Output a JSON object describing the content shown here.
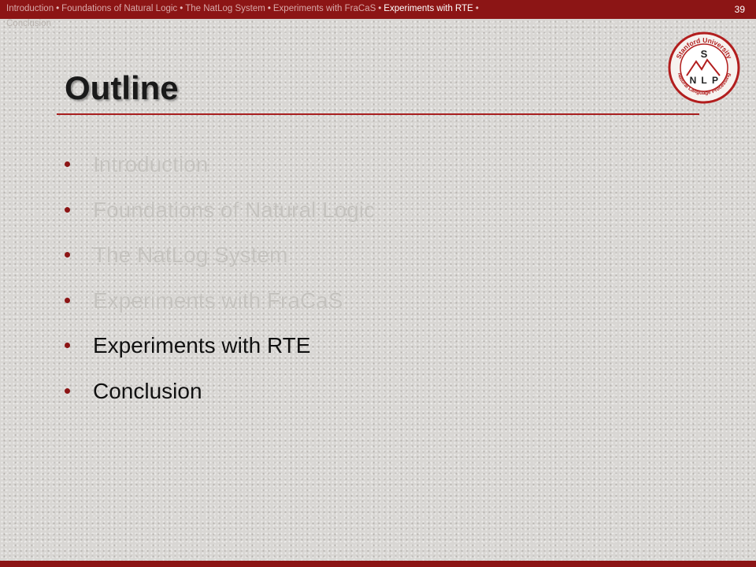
{
  "nav": {
    "items": [
      "Introduction",
      "Foundations of Natural Logic",
      "The NatLog System",
      "Experiments with FraCaS",
      "Experiments with RTE",
      "Conclusion"
    ],
    "separator": "•"
  },
  "page_number": "39",
  "title": "Outline",
  "bullets": [
    "Introduction",
    "Foundations of Natural Logic",
    "The NatLog System",
    "Experiments with FraCaS",
    "Experiments with RTE",
    "Conclusion"
  ],
  "logo": {
    "ring_text_top": "Stanford University",
    "ring_text_bottom": "Natural Language Processing",
    "letters": [
      "S",
      "N",
      "L",
      "P"
    ]
  },
  "colors": {
    "accent": "#8c1515",
    "faded_text": "#c4c2be",
    "active_text": "#111111"
  }
}
